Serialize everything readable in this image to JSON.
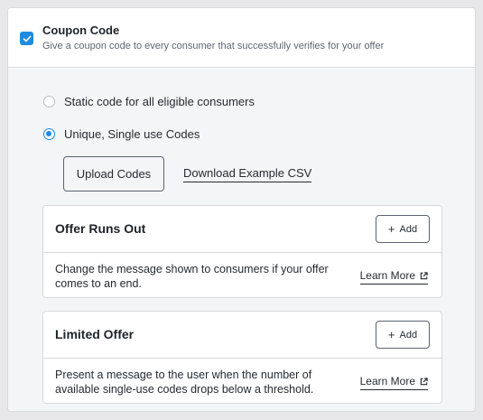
{
  "coupon": {
    "checked": true,
    "title": "Coupon Code",
    "description": "Give a coupon code to every consumer that successfully verifies for your offer"
  },
  "options": [
    {
      "label": "Static code for all eligible consumers",
      "selected": false
    },
    {
      "label": "Unique, Single use Codes",
      "selected": true
    }
  ],
  "upload": {
    "label": "Upload Codes"
  },
  "download": {
    "label": "Download Example CSV"
  },
  "panels": [
    {
      "title": "Offer Runs Out",
      "add_label": "Add",
      "description": "Change the message shown to consumers if your offer comes to an end.",
      "learn_more": "Learn More"
    },
    {
      "title": "Limited Offer",
      "add_label": "Add",
      "description": "Present a message to the user when the number of available single-use codes drops below a threshold.",
      "learn_more": "Learn More"
    }
  ],
  "icons": {
    "checkbox": "check-icon",
    "add": "plus-icon",
    "external": "external-link-icon"
  },
  "colors": {
    "accent": "#1e8be0",
    "background": "#f4f5f6",
    "border": "#d7d9dd"
  }
}
